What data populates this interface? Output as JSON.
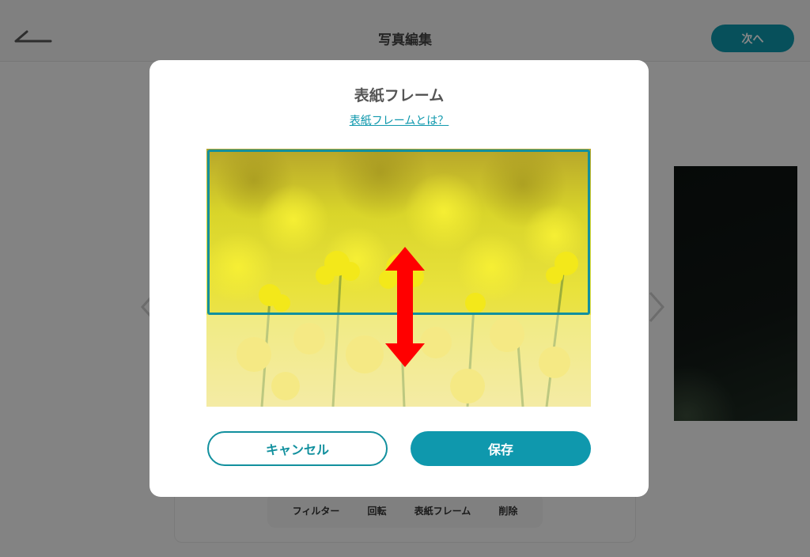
{
  "header": {
    "title": "写真編集",
    "next_label": "次へ",
    "back_icon": "back-arrow-icon"
  },
  "toolbar": {
    "items": [
      {
        "label": "フィルター"
      },
      {
        "label": "回転"
      },
      {
        "label": "表紙フレーム"
      },
      {
        "label": "削除"
      }
    ]
  },
  "modal": {
    "title": "表紙フレーム",
    "help_link": "表紙フレームとは？",
    "cancel_label": "キャンセル",
    "save_label": "保存"
  },
  "colors": {
    "accent": "#0f98ad",
    "frame": "#12909e",
    "arrow": "#ff0000"
  }
}
